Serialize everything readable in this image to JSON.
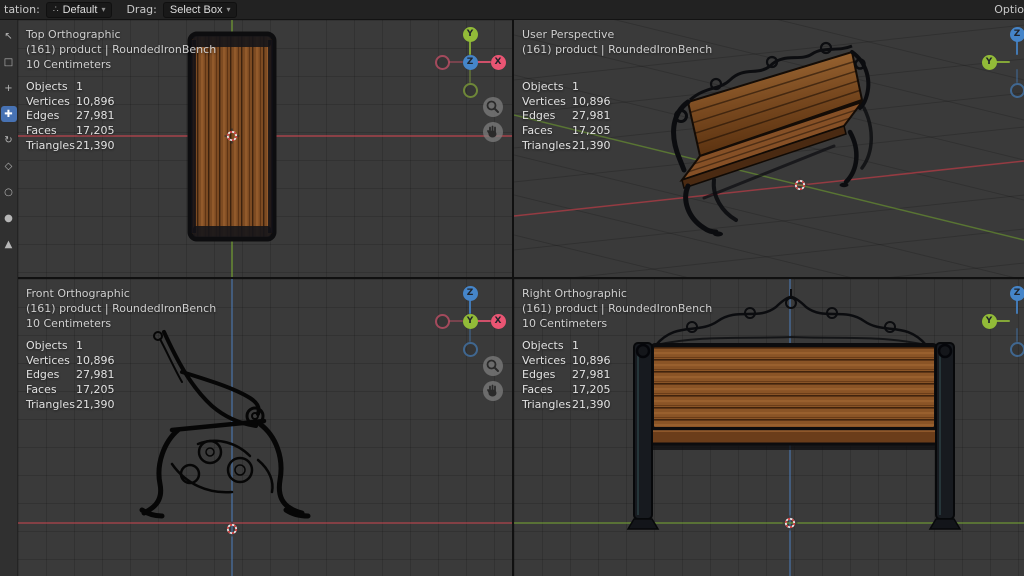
{
  "header": {
    "orientation_label": "tation:",
    "orientation_value": "Default",
    "drag_label": "Drag:",
    "select_value": "Select Box",
    "options_label": "Optio",
    "caret": "▾",
    "orientation_icon_glyph": "∴"
  },
  "toolbar": {
    "tools": [
      {
        "name": "tweak",
        "glyph": "↖"
      },
      {
        "name": "select-box",
        "glyph": "□"
      },
      {
        "name": "cursor",
        "glyph": "+"
      },
      {
        "name": "move",
        "glyph": "✚"
      },
      {
        "name": "rotate",
        "glyph": "↻"
      },
      {
        "name": "scale",
        "glyph": "◇"
      },
      {
        "name": "transform",
        "glyph": "○"
      },
      {
        "name": "annotate",
        "glyph": "●"
      },
      {
        "name": "measure",
        "glyph": "▲"
      }
    ]
  },
  "viewports": [
    {
      "title": "Top Orthographic",
      "subtitle": "(161) product | RoundedIronBench",
      "scale": "10 Centimeters"
    },
    {
      "title": "User Perspective",
      "subtitle": "(161) product | RoundedIronBench",
      "scale": ""
    },
    {
      "title": "Front Orthographic",
      "subtitle": "(161) product | RoundedIronBench",
      "scale": "10 Centimeters"
    },
    {
      "title": "Right Orthographic",
      "subtitle": "(161) product | RoundedIronBench",
      "scale": "10 Centimeters"
    }
  ],
  "stats": {
    "objects_label": "Objects",
    "objects": "1",
    "vertices_label": "Vertices",
    "vertices": "10,896",
    "edges_label": "Edges",
    "edges": "27,981",
    "faces_label": "Faces",
    "faces": "17,205",
    "triangles_label": "Triangles",
    "triangles": "21,390"
  },
  "gizmo": {
    "x": "X",
    "y": "Y",
    "z": "Z"
  },
  "colors": {
    "accent": "#4772b3",
    "axis-x": "#ea5573",
    "axis-y": "#92bb38",
    "axis-z": "#4585c9"
  }
}
